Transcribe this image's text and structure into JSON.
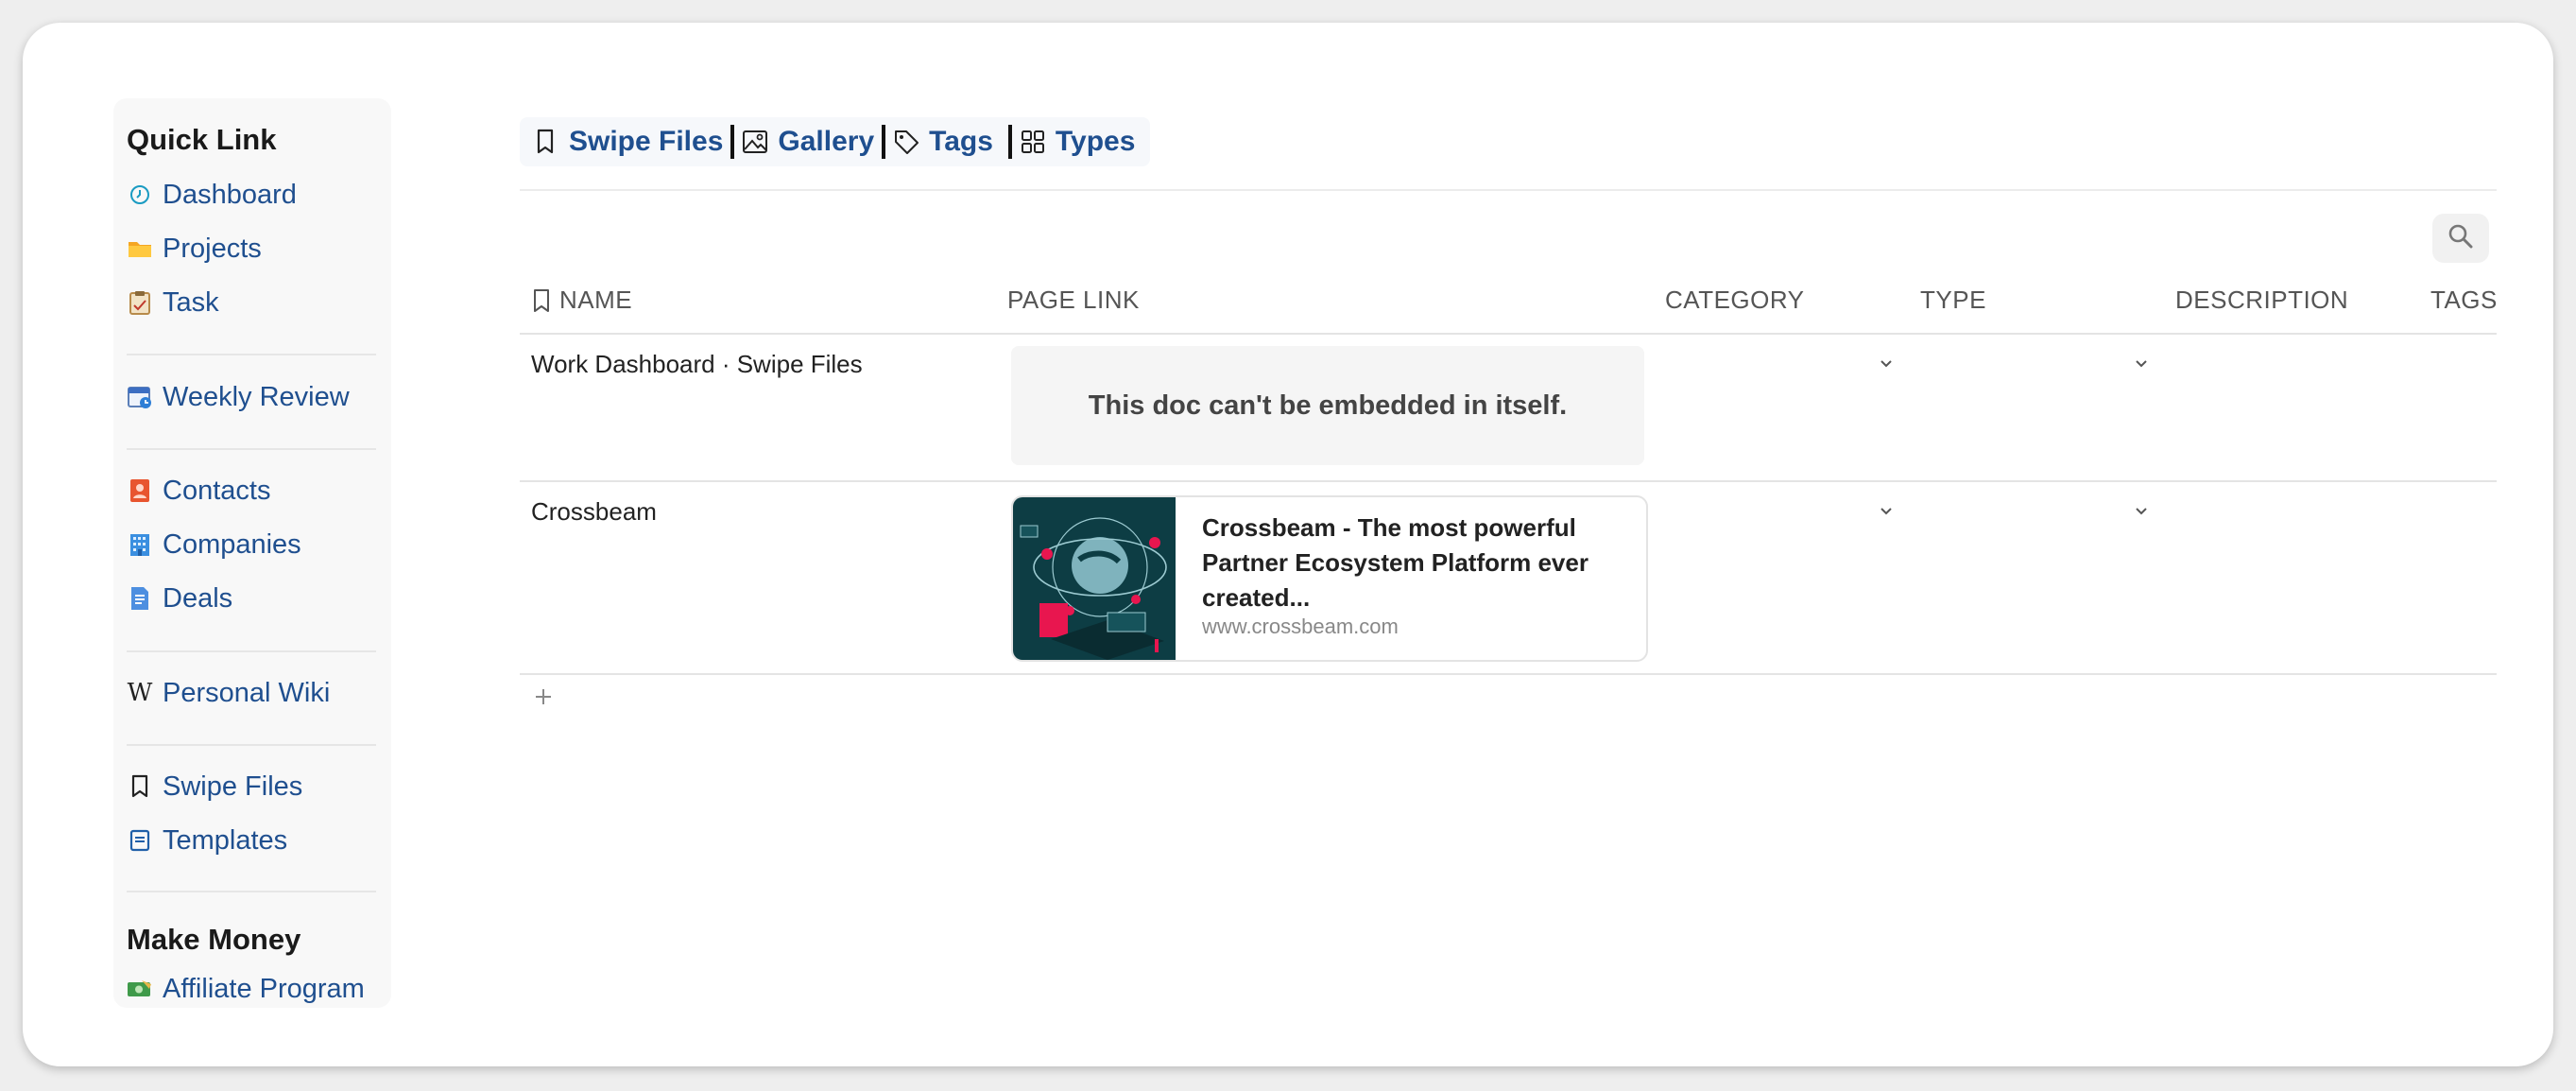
{
  "sidebar": {
    "heading": "Quick Link",
    "groups": [
      {
        "items": [
          {
            "label": "Dashboard",
            "icon": "clock-icon"
          },
          {
            "label": "Projects",
            "icon": "folder-icon"
          },
          {
            "label": "Task",
            "icon": "clipboard-icon"
          }
        ]
      },
      {
        "items": [
          {
            "label": "Weekly Review",
            "icon": "calendar-icon"
          }
        ]
      },
      {
        "items": [
          {
            "label": "Contacts",
            "icon": "contact-book-icon"
          },
          {
            "label": "Companies",
            "icon": "office-building-icon"
          },
          {
            "label": "Deals",
            "icon": "document-icon"
          }
        ]
      },
      {
        "items": [
          {
            "label": "Personal Wiki",
            "icon": "wikipedia-icon"
          }
        ]
      },
      {
        "items": [
          {
            "label": "Swipe Files",
            "icon": "bookmark-icon"
          },
          {
            "label": "Templates",
            "icon": "template-icon"
          }
        ]
      }
    ],
    "section2_heading": "Make Money",
    "section2_items": [
      {
        "label": "Affiliate Program",
        "icon": "money-icon"
      }
    ]
  },
  "tabs": [
    {
      "label": "Swipe Files",
      "icon": "bookmark-icon"
    },
    {
      "label": "Gallery",
      "icon": "image-icon"
    },
    {
      "label": "Tags",
      "icon": "tag-icon"
    },
    {
      "label": "Types",
      "icon": "grid-icon"
    }
  ],
  "table": {
    "columns": [
      "NAME",
      "PAGE LINK",
      "CATEGORY",
      "TYPE",
      "DESCRIPTION",
      "TAGS"
    ],
    "rows": [
      {
        "name": "Work Dashboard · Swipe Files",
        "page_link_message": "This doc can't be embedded in itself."
      },
      {
        "name": "Crossbeam",
        "link_title": "Crossbeam - The most powerful Partner Ecosystem Platform ever created...",
        "link_domain": "www.crossbeam.com"
      }
    ]
  },
  "colors": {
    "link_blue": "#1f4f8f",
    "sidebar_bg": "#f8f8f8",
    "thumb_bg": "#0d3d44",
    "thumb_accent": "#e8164f"
  }
}
